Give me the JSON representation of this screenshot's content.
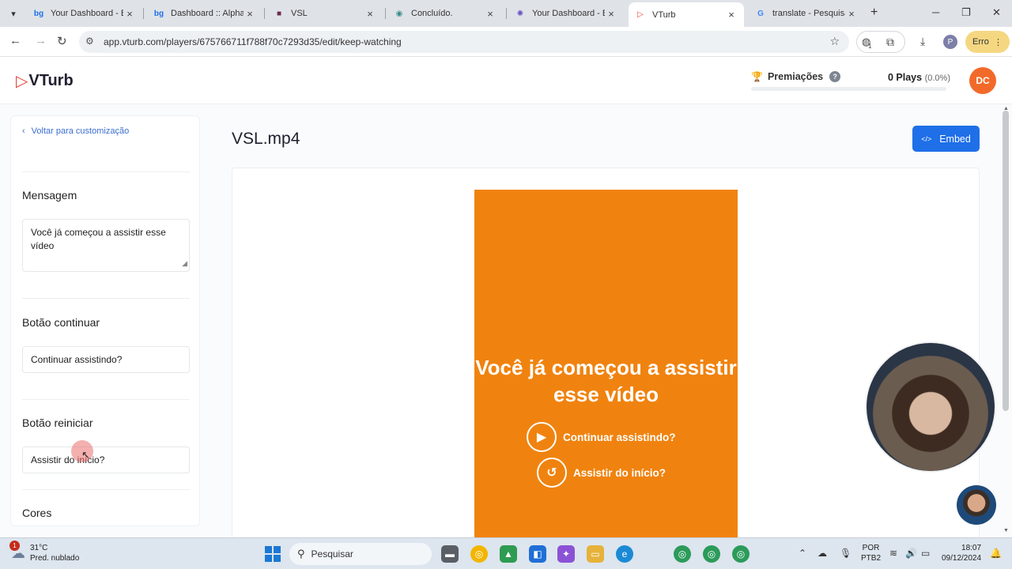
{
  "browser": {
    "tabs": [
      {
        "title": "Your Dashboard - Bu",
        "favicon": "bg"
      },
      {
        "title": "Dashboard :: AlphaBi",
        "favicon": "bg"
      },
      {
        "title": "VSL",
        "favicon": "film"
      },
      {
        "title": "Concluído.",
        "favicon": "globe"
      },
      {
        "title": "Your Dashboard - Bu",
        "favicon": "gear"
      },
      {
        "title": "VTurb",
        "favicon": "vturb",
        "active": true
      },
      {
        "title": "translate - Pesquisa G",
        "favicon": "G"
      }
    ],
    "url": "app.vturb.com/players/675766711f788f70c7293d35/edit/keep-watching",
    "extension_count": "1",
    "profile_initial": "P",
    "error_label": "Erro"
  },
  "header": {
    "logo_text": "VTurb",
    "awards_label": "Premiações",
    "help_label": "?",
    "plays_label": "0 Plays",
    "plays_pct": "(0.0%)",
    "progress_fraction": 0.0,
    "avatar_initials": "DC"
  },
  "sidebar": {
    "back_label": "Voltar para customização",
    "message_title": "Mensagem",
    "message_value": "Você já começou a assistir esse vídeo",
    "continue_title": "Botão continuar",
    "continue_value": "Continuar assistindo?",
    "restart_title": "Botão reiniciar",
    "restart_value": "Assistir do início?",
    "colors_title": "Cores"
  },
  "main": {
    "video_title": "VSL.mp4",
    "embed_label": "Embed",
    "player_bg": "#f0830f",
    "player_message": "Você já começou a assistir esse vídeo",
    "continue_button": "Continuar assistindo?",
    "restart_button": "Assistir do início?"
  },
  "taskbar": {
    "weather_badge": "1",
    "temperature": "31°C",
    "weather_desc": "Pred. nublado",
    "search_label": "Pesquisar",
    "lang_top": "POR",
    "lang_bottom": "PTB2",
    "time": "18:07",
    "date": "09/12/2024"
  }
}
